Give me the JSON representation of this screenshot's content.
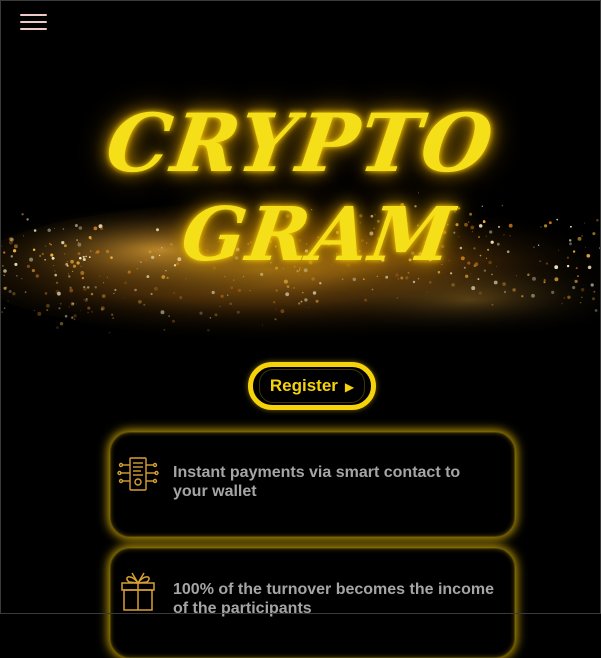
{
  "hero": {
    "title_line1": "CRYPTO",
    "title_line2": "GRAM"
  },
  "nav": {
    "menu_icon": "hamburger-menu-icon"
  },
  "register": {
    "label": "Register",
    "arrow": "▶"
  },
  "features": [
    {
      "icon": "smart-contract-document-icon",
      "text": "Instant payments via smart contact to your wallet"
    },
    {
      "icon": "gift-icon",
      "text": "100% of the turnover becomes the income of the participants"
    }
  ],
  "colors": {
    "accent": "#f5d20a",
    "title": "#f5df18",
    "feature_text": "#a5a5a5",
    "background": "#000000",
    "menu_icon": "#f0c8c8"
  }
}
